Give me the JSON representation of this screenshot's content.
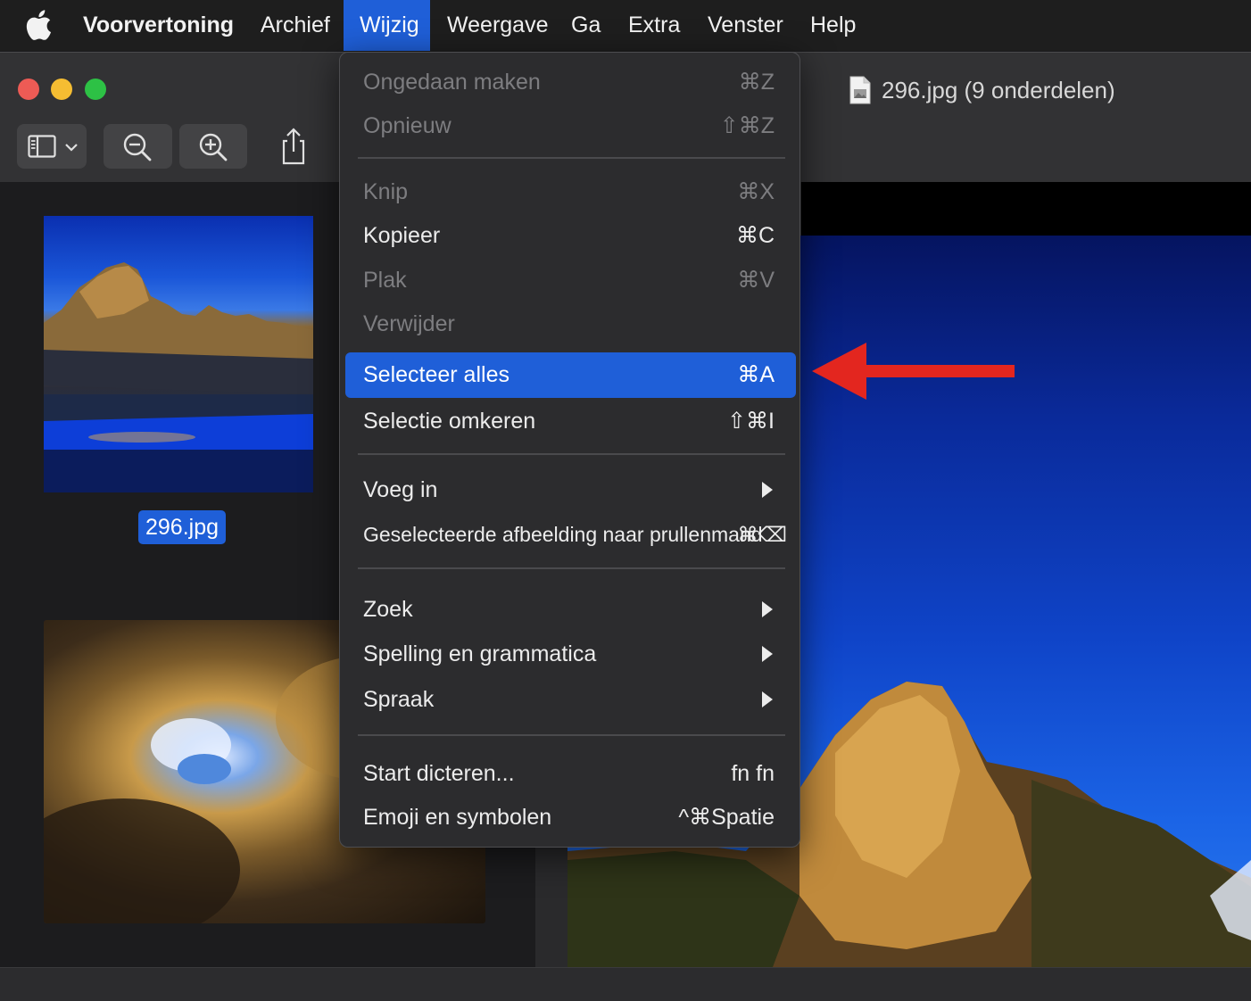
{
  "menubar": {
    "app_name": "Voorvertoning",
    "items": [
      "Archief",
      "Wijzig",
      "Weergave",
      "Ga",
      "Extra",
      "Venster",
      "Help"
    ],
    "active_item": "Wijzig"
  },
  "window": {
    "title": "296.jpg (9 onderdelen)",
    "toolbar": {
      "sidebar_toggle_icon": "sidebar-icon",
      "zoom_out_icon": "zoom-out-icon",
      "zoom_in_icon": "zoom-in-icon",
      "share_icon": "share-icon"
    }
  },
  "sidebar": {
    "selected_thumbnail_label": "296.jpg"
  },
  "edit_menu": {
    "items": [
      {
        "label": "Ongedaan maken",
        "shortcut": "⌘Z",
        "enabled": false
      },
      {
        "label": "Opnieuw",
        "shortcut": "⇧⌘Z",
        "enabled": false
      },
      {
        "label": "Knip",
        "shortcut": "⌘X",
        "enabled": false
      },
      {
        "label": "Kopieer",
        "shortcut": "⌘C",
        "enabled": true
      },
      {
        "label": "Plak",
        "shortcut": "⌘V",
        "enabled": false
      },
      {
        "label": "Verwijder",
        "shortcut": "",
        "enabled": false
      },
      {
        "label": "Selecteer alles",
        "shortcut": "⌘A",
        "enabled": true,
        "highlighted": true
      },
      {
        "label": "Selectie omkeren",
        "shortcut": "⇧⌘I",
        "enabled": true
      },
      {
        "label": "Voeg in",
        "submenu": true
      },
      {
        "label": "Geselecteerde afbeelding naar prullenmand",
        "shortcut": "⌘⌫",
        "enabled": true
      },
      {
        "label": "Zoek",
        "submenu": true
      },
      {
        "label": "Spelling en grammatica",
        "submenu": true
      },
      {
        "label": "Spraak",
        "submenu": true
      },
      {
        "label": "Start dicteren...",
        "shortcut": "fn fn",
        "enabled": true
      },
      {
        "label": "Emoji en symbolen",
        "shortcut": "^⌘Spatie",
        "enabled": true
      }
    ]
  },
  "colors": {
    "accent": "#1f5fd8",
    "annotation_arrow": "#e3261f",
    "traffic_close": "#ed5b55",
    "traffic_minimize": "#f5bd32",
    "traffic_maximize": "#2dc145"
  }
}
